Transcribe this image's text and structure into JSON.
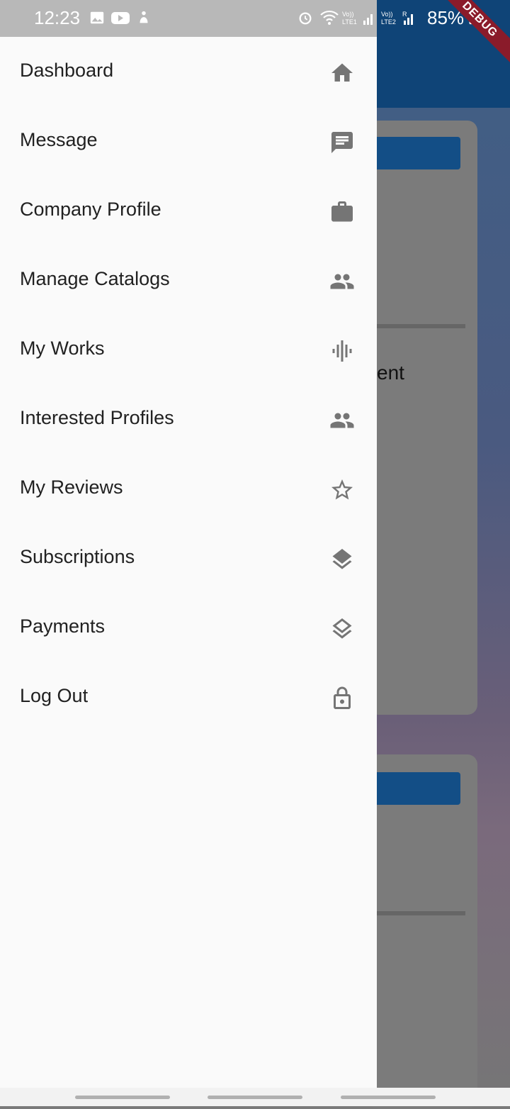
{
  "status": {
    "time": "12:23",
    "battery": "85%",
    "icons": [
      "gallery-icon",
      "youtube-icon",
      "app-icon",
      "alarm-icon",
      "wifi-icon",
      "signal-icon",
      "signal-icon",
      "battery-charging-icon"
    ]
  },
  "debug_label": "DEBUG",
  "background": {
    "partial_text": "ent"
  },
  "drawer": {
    "items": [
      {
        "label": "Dashboard",
        "icon": "home-icon"
      },
      {
        "label": "Message",
        "icon": "message-icon"
      },
      {
        "label": "Company Profile",
        "icon": "briefcase-icon"
      },
      {
        "label": "Manage Catalogs",
        "icon": "people-icon"
      },
      {
        "label": "My Works",
        "icon": "waveform-icon"
      },
      {
        "label": "Interested Profiles",
        "icon": "people-icon"
      },
      {
        "label": "My Reviews",
        "icon": "star-outline-icon"
      },
      {
        "label": "Subscriptions",
        "icon": "layers-icon"
      },
      {
        "label": "Payments",
        "icon": "layers-icon"
      },
      {
        "label": "Log Out",
        "icon": "lock-icon"
      }
    ]
  },
  "colors": {
    "icon": "#757575",
    "text": "#212121",
    "appbar": "#0f4477",
    "drawer_bg": "#fafafa"
  }
}
